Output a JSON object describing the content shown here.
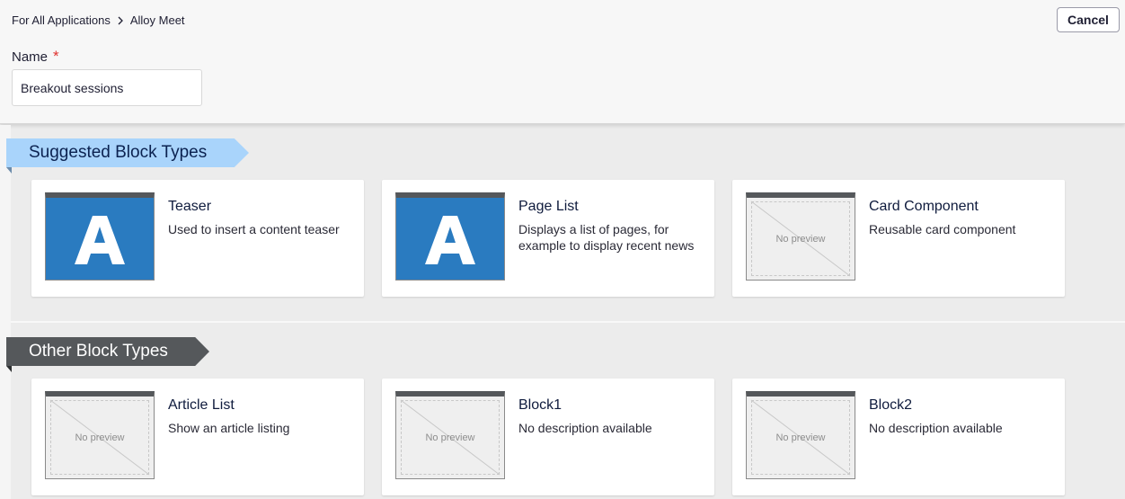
{
  "header": {
    "breadcrumb": [
      "For All Applications",
      "Alloy Meet"
    ],
    "cancel_label": "Cancel",
    "name_label": "Name",
    "required_mark": "*",
    "name_value": "Breakout sessions"
  },
  "sections": {
    "suggested": {
      "title": "Suggested Block Types",
      "color": "#a9d4fb",
      "cards": [
        {
          "title": "Teaser",
          "description": "Used to insert a content teaser",
          "preview": "letter",
          "letter": "A"
        },
        {
          "title": "Page List",
          "description": "Displays a list of pages, for example to display recent news",
          "preview": "letter",
          "letter": "A"
        },
        {
          "title": "Card Component",
          "description": "Reusable card component",
          "preview": "none",
          "preview_text": "No preview"
        }
      ]
    },
    "other": {
      "title": "Other Block Types",
      "color": "#55585b",
      "cards": [
        {
          "title": "Article List",
          "description": "Show an article listing",
          "preview": "none",
          "preview_text": "No preview"
        },
        {
          "title": "Block1",
          "description": "No description available",
          "preview": "none",
          "preview_text": "No preview"
        },
        {
          "title": "Block2",
          "description": "No description available",
          "preview": "none",
          "preview_text": "No preview"
        }
      ]
    }
  },
  "colors": {
    "accent_blue": "#2a7bc0",
    "required": "#e0312e"
  }
}
